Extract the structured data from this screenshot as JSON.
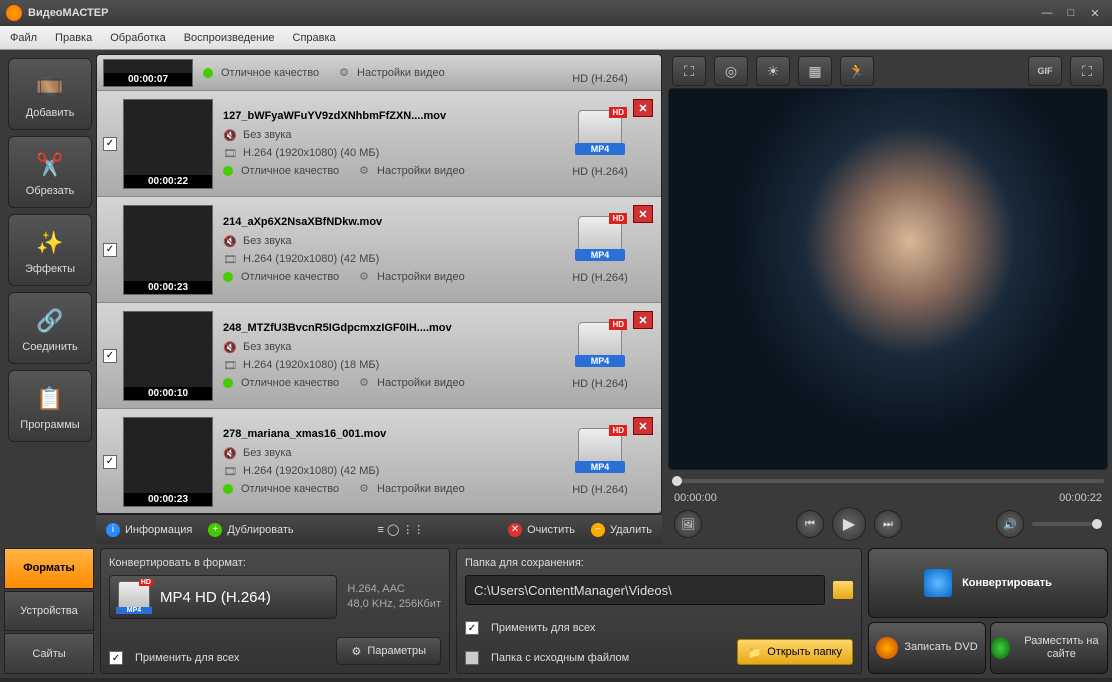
{
  "app": {
    "title": "ВидеоМАСТЕР"
  },
  "menu": {
    "file": "Файл",
    "edit": "Правка",
    "process": "Обработка",
    "playback": "Воспроизведение",
    "help": "Справка"
  },
  "tools": {
    "add": "Добавить",
    "trim": "Обрезать",
    "effects": "Эффекты",
    "join": "Соединить",
    "programs": "Программы"
  },
  "files": [
    {
      "duration": "00:00:07",
      "name": "",
      "audio": "",
      "format": "",
      "quality": "Отличное качество",
      "settings": "Настройки видео",
      "output": "HD (H.264)",
      "fmt_label": "",
      "first": true
    },
    {
      "duration": "00:00:22",
      "name": "127_bWFyaWFuYV9zdXNhbmFfZXN....mov",
      "audio": "Без звука",
      "format": "H.264 (1920x1080) (40 МБ)",
      "quality": "Отличное качество",
      "settings": "Настройки видео",
      "output": "HD (H.264)",
      "fmt_label": "MP4",
      "first": false
    },
    {
      "duration": "00:00:23",
      "name": "214_aXp6X2NsaXBfNDkw.mov",
      "audio": "Без звука",
      "format": "H.264 (1920x1080) (42 МБ)",
      "quality": "Отличное качество",
      "settings": "Настройки видео",
      "output": "HD (H.264)",
      "fmt_label": "MP4",
      "first": false
    },
    {
      "duration": "00:00:10",
      "name": "248_MTZfU3BvcnR5IGdpcmxzIGF0IH....mov",
      "audio": "Без звука",
      "format": "H.264 (1920x1080) (18 МБ)",
      "quality": "Отличное качество",
      "settings": "Настройки видео",
      "output": "HD (H.264)",
      "fmt_label": "MP4",
      "first": false
    },
    {
      "duration": "00:00:23",
      "name": "278_mariana_xmas16_001.mov",
      "audio": "Без звука",
      "format": "H.264 (1920x1080) (42 МБ)",
      "quality": "Отличное качество",
      "settings": "Настройки видео",
      "output": "HD (H.264)",
      "fmt_label": "MP4",
      "first": false
    }
  ],
  "listbar": {
    "info": "Информация",
    "dup": "Дублировать",
    "clear": "Очистить",
    "delete": "Удалить"
  },
  "player": {
    "time_start": "00:00:00",
    "time_end": "00:00:22"
  },
  "tabs": {
    "formats": "Форматы",
    "devices": "Устройства",
    "sites": "Сайты"
  },
  "fmt": {
    "label": "Конвертировать в формат:",
    "name": "MP4 HD (H.264)",
    "sub1": "H.264, AAC",
    "sub2": "48,0 KHz, 256Кбит",
    "apply": "Применить для всех",
    "params": "Параметры",
    "badge": "MP4",
    "hd": "HD"
  },
  "folder": {
    "label": "Папка для сохранения:",
    "path": "C:\\Users\\ContentManager\\Videos\\",
    "apply": "Применить для всех",
    "source": "Папка с исходным файлом",
    "open": "Открыть папку"
  },
  "actions": {
    "convert": "Конвертировать",
    "dvd": "Записать DVD",
    "upload": "Разместить на сайте"
  }
}
